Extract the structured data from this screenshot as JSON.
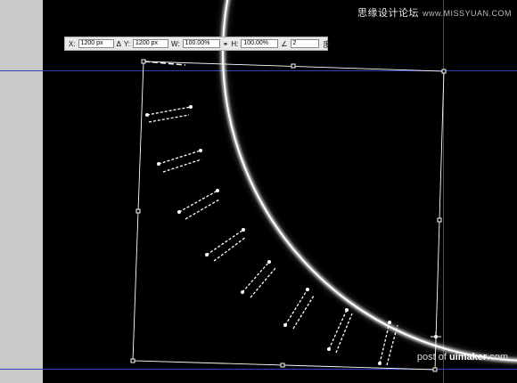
{
  "options_bar": {
    "x_label": "X:",
    "x_value": "1200 px",
    "delta_icon": "delta-icon",
    "y_label": "Y:",
    "y_value": "1200 px",
    "w_label": "W:",
    "w_value": "100.00%",
    "link_icon": "link-icon",
    "h_label": "H:",
    "h_value": "100.00%",
    "angle_icon": "angle-icon",
    "angle_value": "2",
    "angle_unit": "度"
  },
  "watermark_top": {
    "site_cn": "思缘设计论坛",
    "site_url": "www.MISSYUAN.COM"
  },
  "watermark_bottom": {
    "prefix": "post of ",
    "brand": "uimaker",
    "suffix": ".com"
  },
  "colors": {
    "canvas": "#000000",
    "guide": "#2f3fbf",
    "panel": "#c9c9c9",
    "glow": "#ffffff"
  }
}
